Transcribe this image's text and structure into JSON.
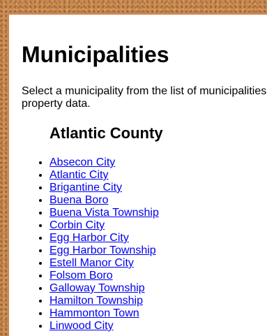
{
  "page": {
    "title": "Municipalities",
    "intro": "Select a municipality from the list of municipalities property data."
  },
  "county": {
    "name": "Atlantic County",
    "municipalities": [
      "Absecon City",
      "Atlantic City",
      "Brigantine City",
      "Buena Boro",
      "Buena Vista Township",
      "Corbin City",
      "Egg Harbor City",
      "Egg Harbor Township",
      "Estell Manor City",
      "Folsom Boro",
      "Galloway Township",
      "Hamilton Township",
      "Hammonton Town",
      "Linwood City"
    ]
  },
  "colors": {
    "link": "#0000ee",
    "background_corkboard": "#c98a52",
    "content_background": "#ffffff"
  }
}
